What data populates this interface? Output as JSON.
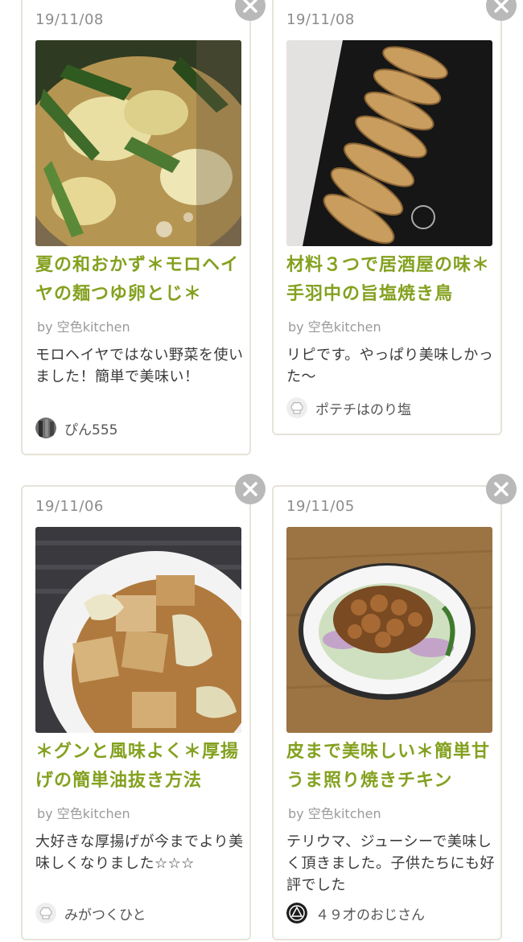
{
  "cards": [
    {
      "date": "19/11/08",
      "title": "夏の和おかず＊モロヘイヤの麺つゆ卵とじ＊",
      "author": "by 空色kitchen",
      "comment": "モロヘイヤではない野菜を使いました！簡単で美味い！",
      "commenter": "ぴん555",
      "avatar_icon": "user-photo-icon",
      "close_icon": "close-icon"
    },
    {
      "date": "19/11/08",
      "title": "材料３つで居酒屋の味＊手羽中の旨塩焼き鳥",
      "author": "by 空色kitchen",
      "comment": "リピです。やっぱり美味しかった〜",
      "commenter": "ポテチはのり塩",
      "avatar_icon": "chef-hat-icon",
      "close_icon": "close-icon"
    },
    {
      "date": "19/11/06",
      "title": "＊グンと風味よく＊厚揚げの簡単油抜き方法",
      "author": "by 空色kitchen",
      "comment": "大好きな厚揚げが今までより美味しくなりました☆☆☆",
      "commenter": "みがつくひと",
      "avatar_icon": "chef-hat-icon",
      "close_icon": "close-icon"
    },
    {
      "date": "19/11/05",
      "title": "皮まで美味しい＊簡単甘うま照り焼きチキン",
      "author": "by 空色kitchen",
      "comment": "テリウマ、ジューシーで美味しく頂きました。子供たちにも好評でした",
      "commenter": "４９才のおじさん",
      "avatar_icon": "emblem-icon",
      "close_icon": "close-icon"
    }
  ],
  "colors": {
    "title_green": "#84a11f",
    "border": "#e6e3d8",
    "close_bg": "#b9b9b9"
  }
}
